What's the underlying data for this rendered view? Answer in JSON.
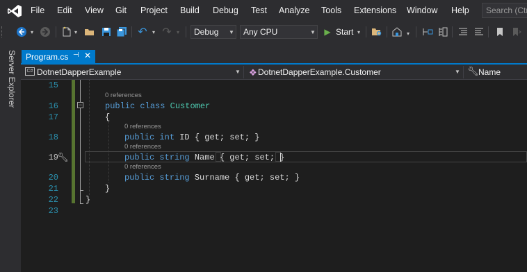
{
  "menu": {
    "items": [
      "File",
      "Edit",
      "View",
      "Git",
      "Project",
      "Build",
      "Debug",
      "Test",
      "Analyze",
      "Tools",
      "Extensions",
      "Window",
      "Help"
    ],
    "search_placeholder": "Search (Ctr"
  },
  "toolbar": {
    "configuration": "Debug",
    "platform": "Any CPU",
    "start_label": "Start"
  },
  "side_panel": {
    "server_explorer_label": "Server Explorer"
  },
  "document_tab": {
    "file_name": "Program.cs"
  },
  "navigation": {
    "project": "DotnetDapperExample",
    "type": "DotnetDapperExample.Customer",
    "member": "Name",
    "csharp_badge": "C#"
  },
  "editor": {
    "line_numbers": [
      "15",
      "16",
      "17",
      "18",
      "19",
      "20",
      "21",
      "22",
      "23"
    ],
    "references_label": "0 references",
    "lines": {
      "line16_public": "public",
      "line16_class": "class",
      "line16_name": "Customer",
      "line17": "{",
      "line18_public": "public",
      "line18_type": "int",
      "line18_rest": "ID { get; set; }",
      "line19_public": "public",
      "line19_type": "string",
      "line19_name": "Name",
      "line19_accessors": "{ get; set; }",
      "line20_public": "public",
      "line20_type": "string",
      "line20_rest": "Surname { get; set; }",
      "line21": "}",
      "line22": "}"
    }
  },
  "colors": {
    "accent": "#007acc",
    "keyword": "#569cd6",
    "type": "#4ec9b0",
    "line_number": "#2b91af",
    "change_bar": "#577430",
    "start_play": "#6ab04c"
  }
}
